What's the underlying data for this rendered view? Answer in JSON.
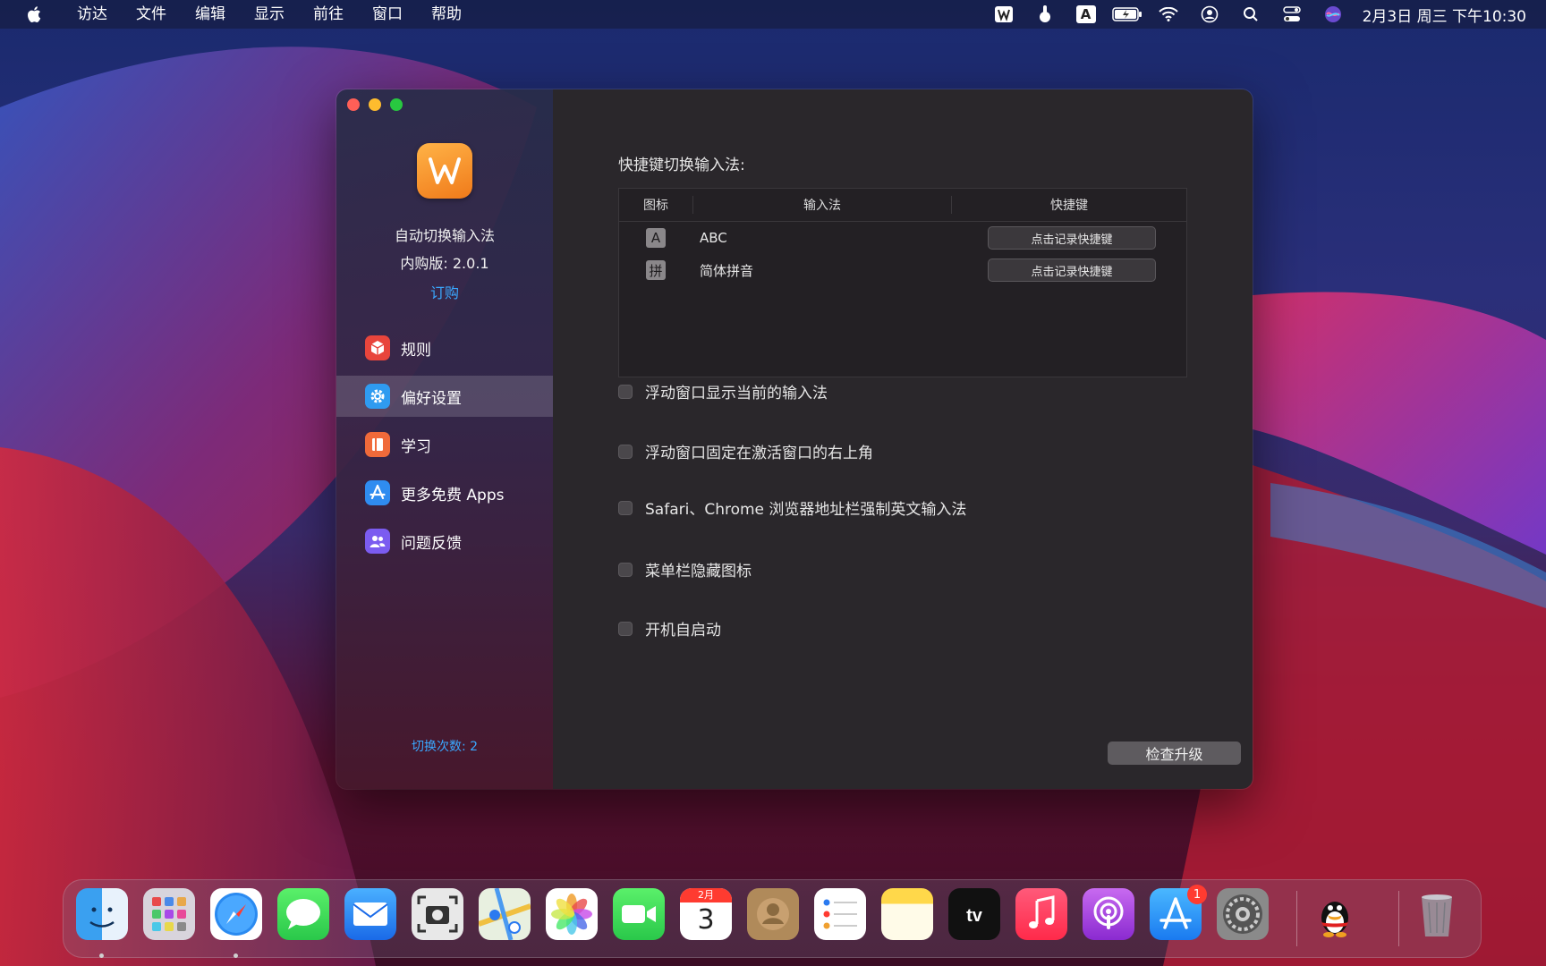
{
  "menubar": {
    "app_menus": [
      "访达",
      "文件",
      "编辑",
      "显示",
      "前往",
      "窗口",
      "帮助"
    ],
    "status_icons": [
      "app-w-icon",
      "brightness-icon",
      "input-source-icon",
      "battery-icon",
      "wifi-icon",
      "user-icon",
      "search-icon",
      "control-center-icon",
      "siri-icon"
    ],
    "input_source_letter": "A",
    "clock": "2月3日 周三 下午10:30"
  },
  "sidebar": {
    "app_name": "自动切换输入法",
    "version": "内购版: 2.0.1",
    "buy_label": "订购",
    "items": [
      {
        "label": "规则",
        "icon": "rules-icon",
        "color": "#e8453c"
      },
      {
        "label": "偏好设置",
        "icon": "gear-icon",
        "color": "#2f9bf0"
      },
      {
        "label": "学习",
        "icon": "book-icon",
        "color": "#f06a3a"
      },
      {
        "label": "更多免费 Apps",
        "icon": "app-store-icon",
        "color": "#2f8cf0"
      },
      {
        "label": "问题反馈",
        "icon": "people-icon",
        "color": "#7b5cf0"
      }
    ],
    "switch_count": "切换次数: 2"
  },
  "main": {
    "shortcut_title": "快捷键切换输入法:",
    "table": {
      "headers": [
        "图标",
        "输入法",
        "快捷键"
      ],
      "rows": [
        {
          "glyph": "A",
          "method": "ABC",
          "button": "点击记录快捷键"
        },
        {
          "glyph": "拼",
          "method": "简体拼音",
          "button": "点击记录快捷键"
        }
      ]
    },
    "options": [
      "浮动窗口显示当前的输入法",
      "浮动窗口固定在激活窗口的右上角",
      "Safari、Chrome 浏览器地址栏强制英文输入法",
      "菜单栏隐藏图标",
      "开机自启动"
    ],
    "upgrade_button": "检查升级"
  },
  "dock": {
    "apps": [
      "finder-icon",
      "launchpad-icon",
      "safari-icon",
      "messages-icon",
      "mail-icon",
      "screenshot-icon",
      "maps-icon",
      "photos-icon",
      "facetime-icon",
      "calendar-icon",
      "contacts-icon",
      "reminders-icon",
      "notes-icon",
      "apple-tv-icon",
      "music-icon",
      "podcasts-icon",
      "app-store-icon",
      "system-preferences-icon",
      "qq-icon",
      "trash-icon"
    ],
    "calendar_month": "2月",
    "calendar_day": "3",
    "app_store_badge": "1"
  }
}
